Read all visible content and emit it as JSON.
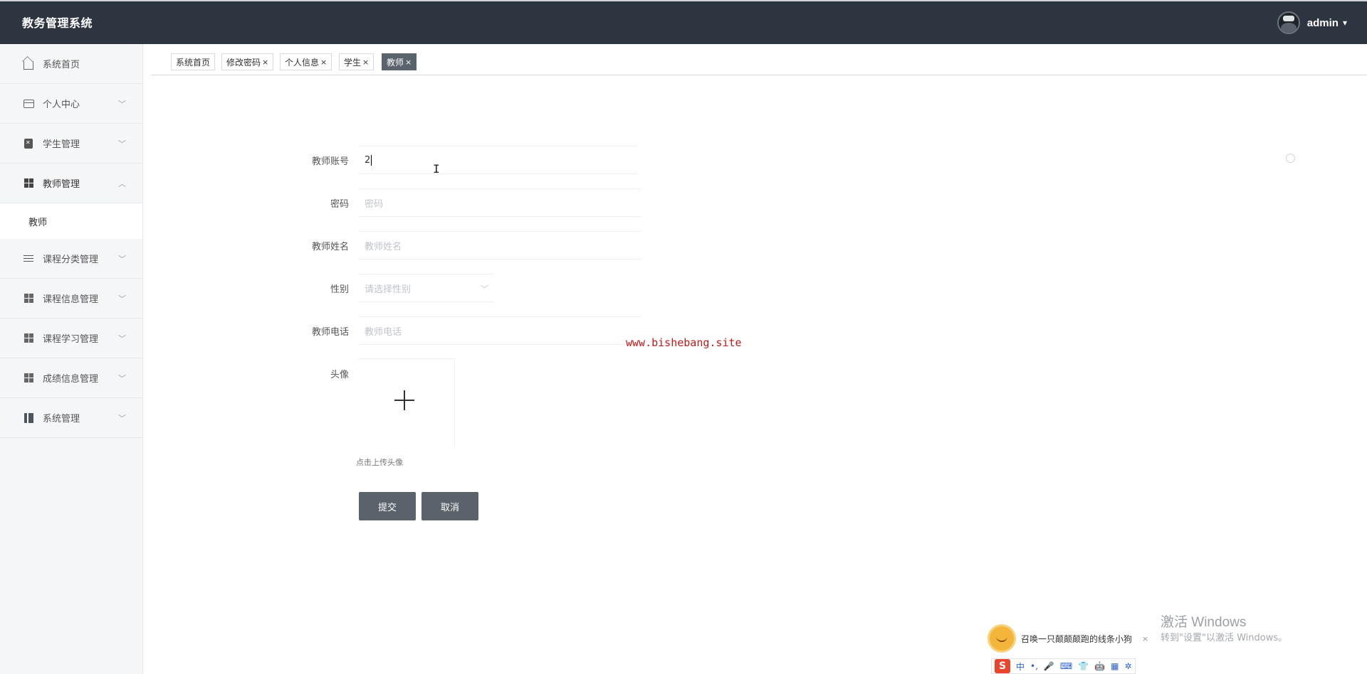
{
  "header": {
    "app_title": "教务管理系统",
    "username": "admin",
    "caret": "▾"
  },
  "sidebar": {
    "items": [
      {
        "label": "系统首页",
        "icon": "home-icon"
      },
      {
        "label": "个人中心",
        "icon": "wallet-icon",
        "arrow": "﹀"
      },
      {
        "label": "学生管理",
        "icon": "clipboard-icon",
        "arrow": "﹀"
      },
      {
        "label": "教师管理",
        "icon": "grid-icon",
        "arrow": "︿"
      },
      {
        "label": "课程分类管理",
        "icon": "sliders-icon",
        "arrow": "﹀"
      },
      {
        "label": "课程信息管理",
        "icon": "grid-icon",
        "arrow": "﹀"
      },
      {
        "label": "课程学习管理",
        "icon": "grid-icon",
        "arrow": "﹀"
      },
      {
        "label": "成绩信息管理",
        "icon": "grid-icon",
        "arrow": "﹀"
      },
      {
        "label": "系统管理",
        "icon": "book-icon",
        "arrow": "﹀"
      }
    ],
    "submenu": {
      "label": "教师"
    }
  },
  "tabs": [
    {
      "label": "系统首页",
      "close": ""
    },
    {
      "label": "修改密码",
      "close": "×"
    },
    {
      "label": "个人信息",
      "close": "×"
    },
    {
      "label": "学生",
      "close": "×"
    },
    {
      "label": "教师",
      "close": "×"
    }
  ],
  "form": {
    "account": {
      "label": "教师账号",
      "value": "2"
    },
    "password": {
      "label": "密码",
      "placeholder": "密码"
    },
    "name": {
      "label": "教师姓名",
      "placeholder": "教师姓名"
    },
    "gender": {
      "label": "性别",
      "placeholder": "请选择性别",
      "arrow": "﹀"
    },
    "phone": {
      "label": "教师电话",
      "placeholder": "教师电话"
    },
    "avatar": {
      "label": "头像",
      "hint": "点击上传头像"
    },
    "submit_label": "提交",
    "cancel_label": "取消"
  },
  "watermark": "www.bishebang.site",
  "windows_activation": {
    "title": "激活 Windows",
    "subtitle": "转到\"设置\"以激活 Windows。"
  },
  "ime": {
    "tip": "召唤一只颠颠颠跑的线条小狗",
    "close": "×",
    "logo": "S",
    "buttons": [
      "中",
      "•,",
      "🎤",
      "⌨",
      "👕",
      "🤖",
      "▦",
      "✲"
    ]
  }
}
